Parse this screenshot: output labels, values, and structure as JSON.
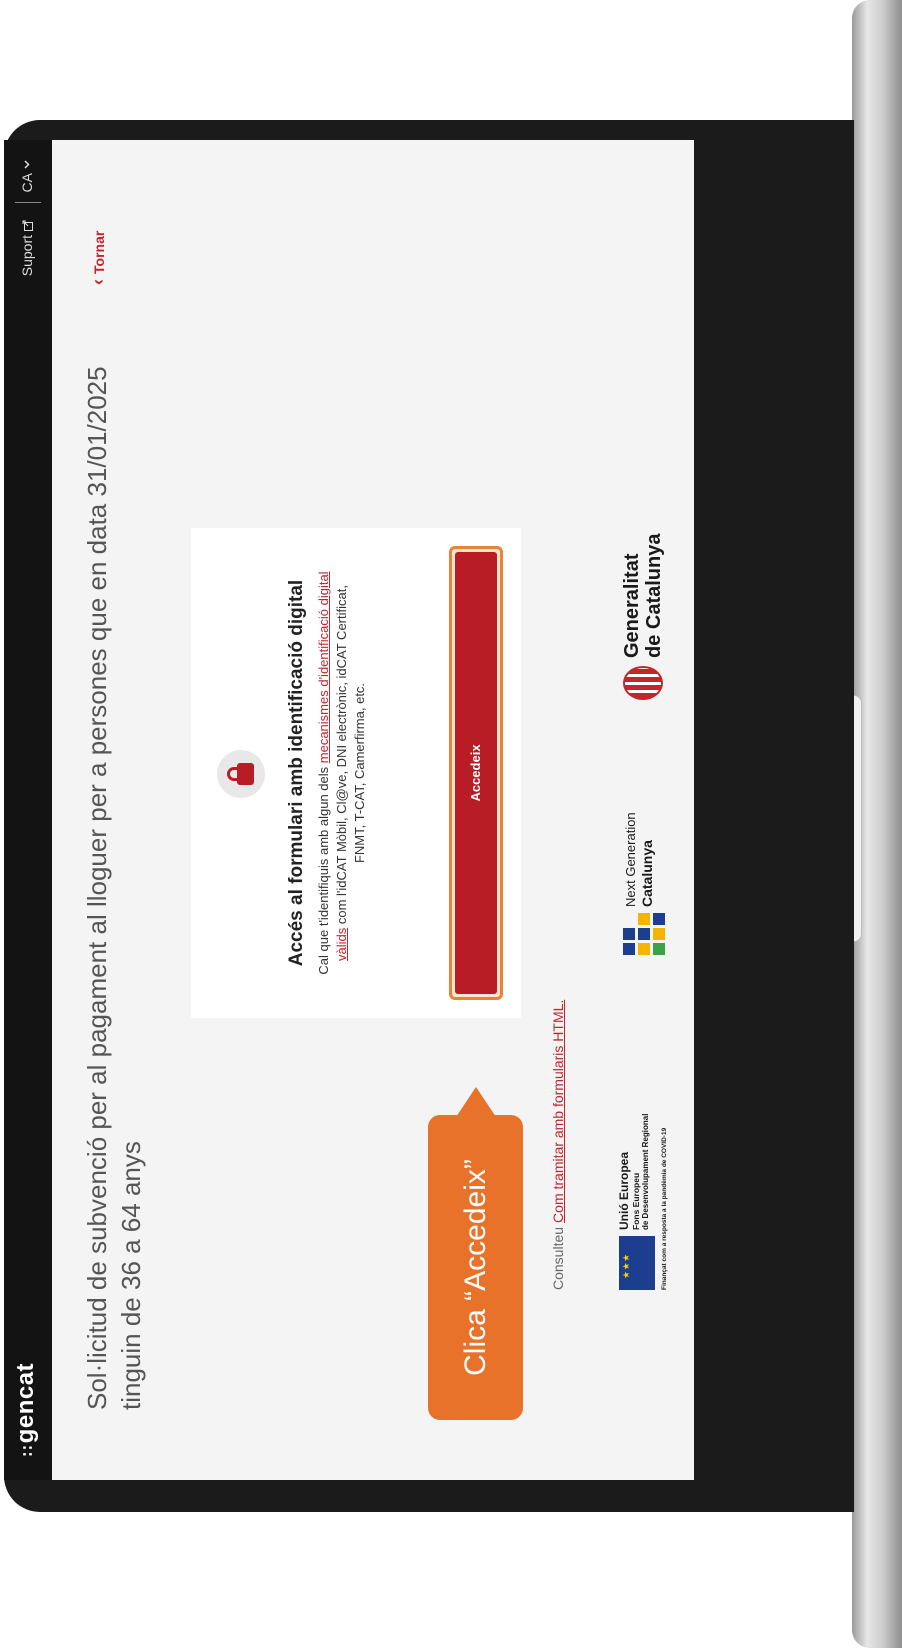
{
  "header": {
    "logo_dots": "∷",
    "logo": "gencat",
    "support_label": "Suport",
    "support_icon": "external-link-icon",
    "language": "CA",
    "language_icon": "chevron-down-icon"
  },
  "page": {
    "title": "Sol·licitud de subvenció per al pagament al lloguer per a persones que en data 31/01/2025 tinguin de 36 a 64 anys",
    "back_label": "Tornar",
    "back_icon": "chevron-left-icon"
  },
  "access_card": {
    "icon": "lock-icon",
    "heading": "Accés al formulari amb identificació digital",
    "text_before_link": "Cal que t'identifiquis amb algun dels ",
    "link_text": "mecanismes d'identificació digital vàlids",
    "text_after_link": " com l'idCAT Mòbil, Cl@ve, DNI electrònic, idCAT Certificat, FNMT, T-CAT, Camerfirma, etc.",
    "button_label": "Accedeix"
  },
  "help": {
    "prefix": "Consulteu",
    "link_text": "Com tramitar amb formularis HTML."
  },
  "footer_logos": {
    "eu_line1": "Unió Europea",
    "eu_line2": "Fons Europeu",
    "eu_line3": "de Desenvolupament Regional",
    "eu_line4": "Finançat com a resposta a la pandèmia de COVID-19",
    "eu_stars": "★ ★ ★",
    "ng_line1": "Next Generation",
    "ng_line2": "Catalunya",
    "gc_line1": "Generalitat",
    "gc_line2": "de Catalunya"
  },
  "tooltip": {
    "text": "Clica “Accedeix”"
  },
  "colors": {
    "brand_red": "#b81c24",
    "tooltip_orange": "#e8722a"
  }
}
